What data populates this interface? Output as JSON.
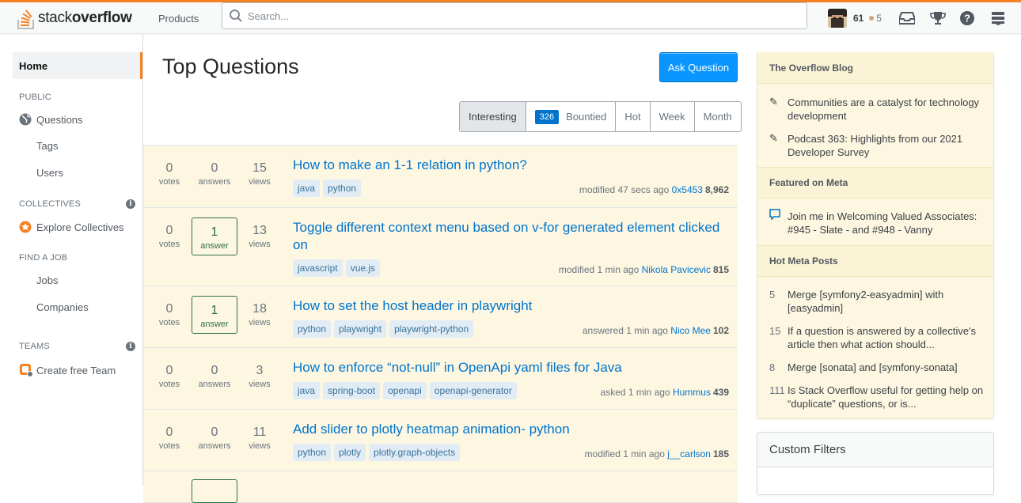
{
  "header": {
    "logo_light": "stack",
    "logo_bold": "overflow",
    "products_label": "Products",
    "search_placeholder": "Search...",
    "reputation": "61",
    "bronze_badges": "5",
    "icons": [
      "inbox-icon",
      "achievements-icon",
      "help-icon",
      "site-switcher-icon"
    ]
  },
  "sidebar": {
    "home": "Home",
    "public_label": "PUBLIC",
    "questions": "Questions",
    "tags": "Tags",
    "users": "Users",
    "collectives_label": "COLLECTIVES",
    "explore_collectives": "Explore Collectives",
    "find_job_label": "FIND A JOB",
    "jobs": "Jobs",
    "companies": "Companies",
    "teams_label": "TEAMS",
    "create_team": "Create free Team"
  },
  "main": {
    "title": "Top Questions",
    "ask_button": "Ask Question",
    "filters": {
      "interesting": "Interesting",
      "bountied_count": "326",
      "bountied": "Bountied",
      "hot": "Hot",
      "week": "Week",
      "month": "Month"
    },
    "questions": [
      {
        "votes": "0",
        "votes_label": "votes",
        "answers": "0",
        "answers_label": "answers",
        "views": "15",
        "views_label": "views",
        "title": "How to make an 1-1 relation in python?",
        "tags": [
          "java",
          "python"
        ],
        "action": "modified 47 secs ago",
        "user": "0x5453",
        "rep": "8,962"
      },
      {
        "votes": "0",
        "votes_label": "votes",
        "answers": "1",
        "answers_label": "answer",
        "views": "13",
        "views_label": "views",
        "title": "Toggle different context menu based on v-for generated element clicked on",
        "tags": [
          "javascript",
          "vue.js"
        ],
        "action": "modified 1 min ago",
        "user": "Nikola Pavicevic",
        "rep": "815"
      },
      {
        "votes": "0",
        "votes_label": "votes",
        "answers": "1",
        "answers_label": "answer",
        "views": "18",
        "views_label": "views",
        "title": "How to set the host header in playwright",
        "tags": [
          "python",
          "playwright",
          "playwright-python"
        ],
        "action": "answered 1 min ago",
        "user": "Nico Mee",
        "rep": "102"
      },
      {
        "votes": "0",
        "votes_label": "votes",
        "answers": "0",
        "answers_label": "answers",
        "views": "3",
        "views_label": "views",
        "title": "How to enforce “not-null” in OpenApi yaml files for Java",
        "tags": [
          "java",
          "spring-boot",
          "openapi",
          "openapi-generator"
        ],
        "action": "asked 1 min ago",
        "user": "Hummus",
        "rep": "439"
      },
      {
        "votes": "0",
        "votes_label": "votes",
        "answers": "0",
        "answers_label": "answers",
        "views": "11",
        "views_label": "views",
        "title": "Add slider to plotly heatmap animation- python",
        "tags": [
          "python",
          "plotly",
          "plotly.graph-objects"
        ],
        "action": "modified 1 min ago",
        "user": "j__carlson",
        "rep": "185"
      }
    ]
  },
  "right": {
    "blog_title": "The Overflow Blog",
    "blog_items": [
      "Communities are a catalyst for technology development",
      "Podcast 363: Highlights from our 2021 Developer Survey"
    ],
    "meta_title": "Featured on Meta",
    "meta_items": [
      "Join me in Welcoming Valued Associates: #945 - Slate - and #948 - Vanny"
    ],
    "hot_title": "Hot Meta Posts",
    "hot_items": [
      {
        "count": "5",
        "text": "Merge [symfony2-easyadmin] with [easyadmin]"
      },
      {
        "count": "15",
        "text": "If a question is answered by a collective's article then what action should..."
      },
      {
        "count": "8",
        "text": "Merge [sonata] and [symfony-sonata]"
      },
      {
        "count": "111",
        "text": "Is Stack Overflow useful for getting help on “duplicate” questions, or is..."
      }
    ],
    "custom_filters": "Custom Filters"
  },
  "colors": {
    "accent": "#f48225",
    "link": "#0074cc",
    "button": "#0a95ff",
    "question_bg": "#fdf7e2",
    "answered": "#2f6f44"
  }
}
